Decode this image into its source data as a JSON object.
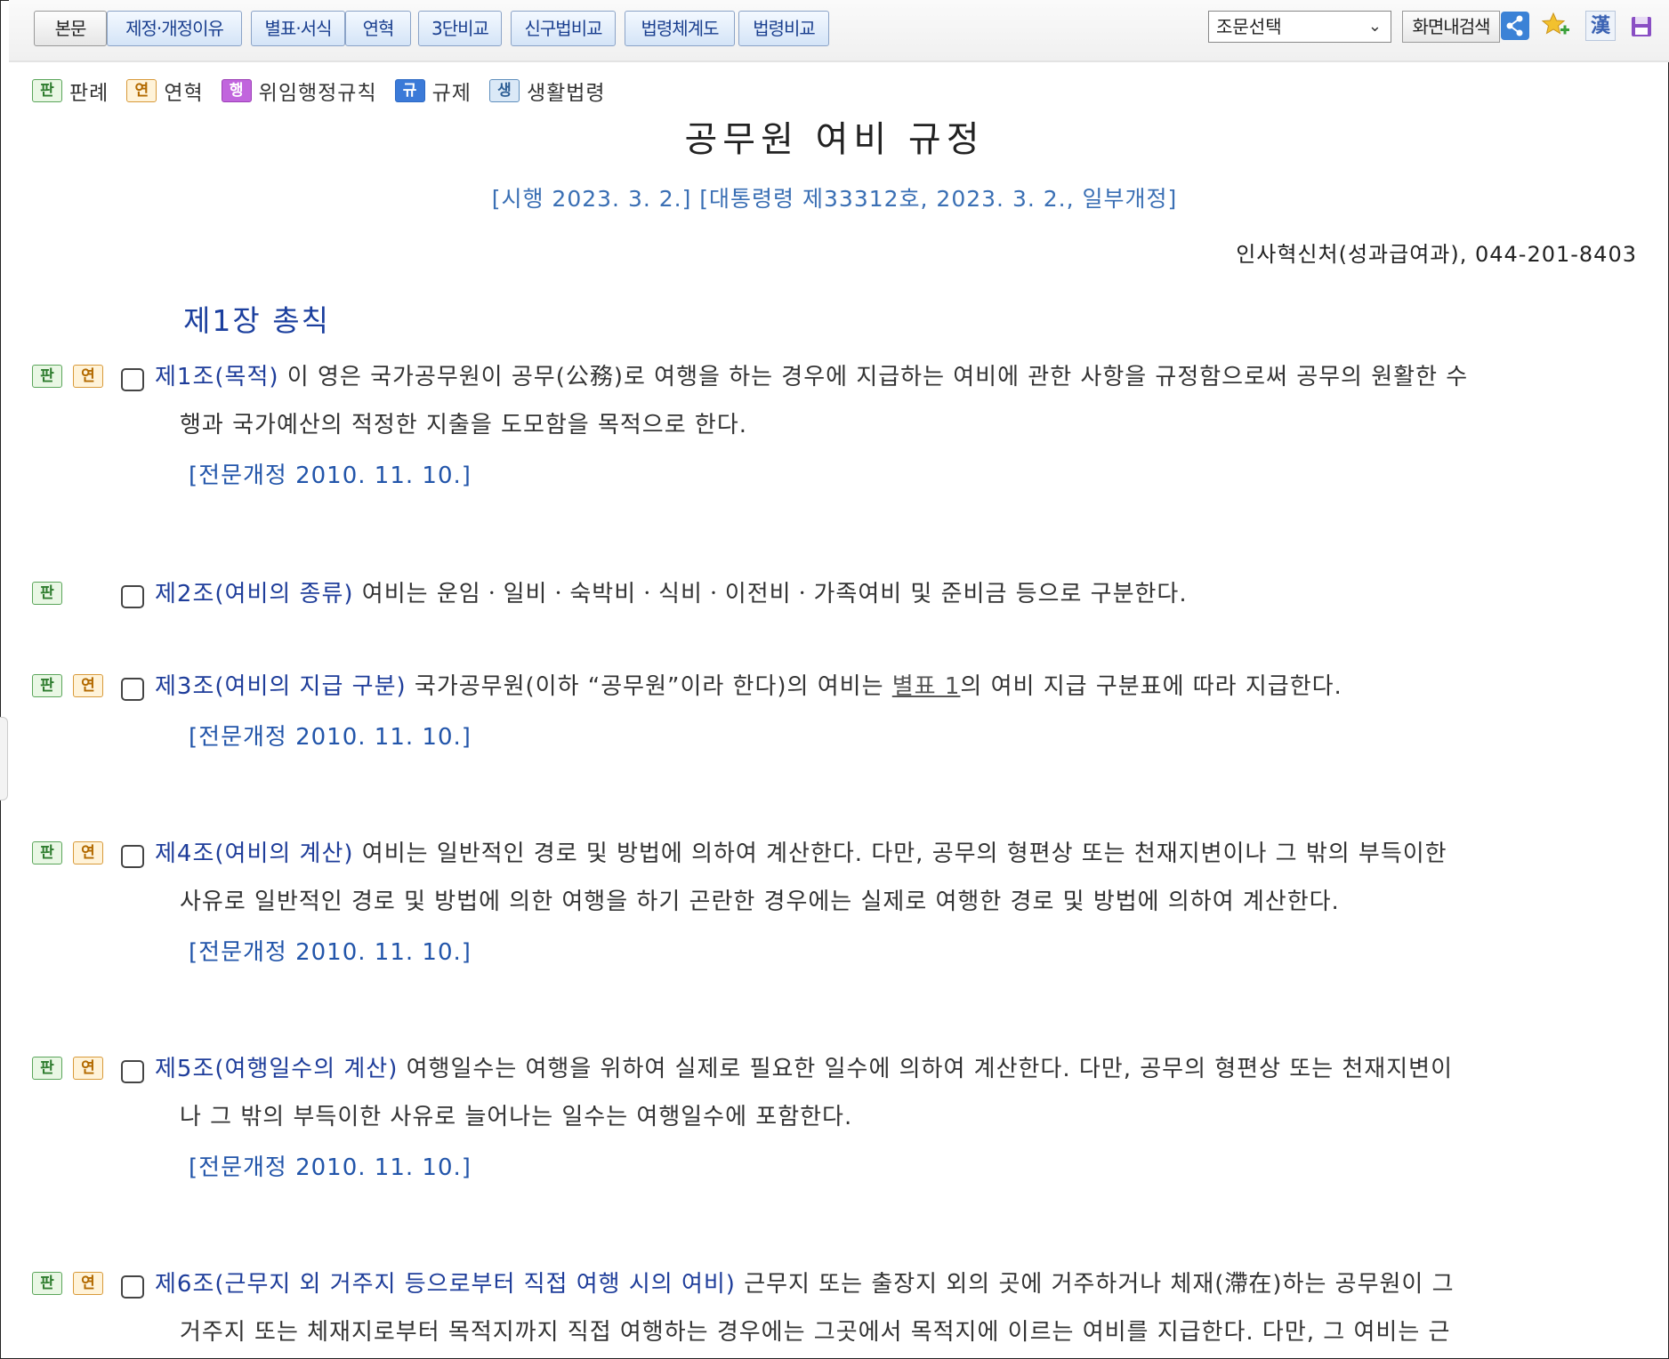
{
  "toolbar": {
    "buttons": [
      "본문",
      "제정·개정이유",
      "별표·서식",
      "연혁",
      "3단비교",
      "신구법비교",
      "법령체계도",
      "법령비교"
    ],
    "article_select": "조문선택",
    "search_button": "화면내검색",
    "icons": [
      "share-icon",
      "favorite-add-icon",
      "hanja-icon",
      "save-icon"
    ],
    "hanja_glyph": "漢"
  },
  "legend": [
    {
      "badge": "판",
      "label": "판례"
    },
    {
      "badge": "연",
      "label": "연혁"
    },
    {
      "badge": "행",
      "label": "위임행정규칙"
    },
    {
      "badge": "규",
      "label": "규제"
    },
    {
      "badge": "생",
      "label": "생활법령"
    }
  ],
  "law": {
    "title": "공무원 여비 규정",
    "enforcement": "[시행 2023. 3. 2.] [대통령령 제33312호, 2023. 3. 2., 일부개정]",
    "department": "인사혁신처(성과급여과), 044-201-8403",
    "chapter": "제1장 총칙"
  },
  "articles": [
    {
      "heading": "제1조(목적)",
      "line1": " 이 영은 국가공무원이 공무(公務)로 여행을 하는 경우에 지급하는 여비에 관한 사항을 규정함으로써 공무의 원활한 수",
      "line2": "행과 국가예산의 적정한 지출을 도모함을 목적으로 한다.",
      "revision": "[전문개정 2010. 11. 10.]",
      "badges": [
        "판",
        "연"
      ]
    },
    {
      "heading": "제2조(여비의 종류)",
      "line1": " 여비는 운임ㆍ일비ㆍ숙박비ㆍ식비ㆍ이전비ㆍ가족여비 및 준비금 등으로 구분한다.",
      "badges": [
        "판"
      ]
    },
    {
      "heading": "제3조(여비의 지급 구분)",
      "line1_pre": " 국가공무원(이하 “공무원”이라 한다)의 여비는 ",
      "line1_link": "별표 1",
      "line1_post": "의 여비 지급 구분표에 따라 지급한다.",
      "revision": "[전문개정 2010. 11. 10.]",
      "badges": [
        "판",
        "연"
      ]
    },
    {
      "heading": "제4조(여비의 계산)",
      "line1": " 여비는 일반적인 경로 및 방법에 의하여 계산한다. 다만, 공무의 형편상 또는 천재지변이나 그 밖의 부득이한",
      "line2": "사유로 일반적인 경로 및 방법에 의한 여행을 하기 곤란한 경우에는 실제로 여행한 경로 및 방법에 의하여 계산한다.",
      "revision": "[전문개정 2010. 11. 10.]",
      "badges": [
        "판",
        "연"
      ]
    },
    {
      "heading": "제5조(여행일수의 계산)",
      "line1": " 여행일수는 여행을 위하여 실제로 필요한 일수에 의하여 계산한다. 다만, 공무의 형편상 또는 천재지변이",
      "line2": "나 그 밖의 부득이한 사유로 늘어나는 일수는 여행일수에 포함한다.",
      "revision": "[전문개정 2010. 11. 10.]",
      "badges": [
        "판",
        "연"
      ]
    },
    {
      "heading": "제6조(근무지 외 거주지 등으로부터 직접 여행 시의 여비)",
      "line1": " 근무지 또는 출장지 외의 곳에 거주하거나 체재(滯在)하는 공무원이 그",
      "line2": "거주지 또는 체재지로부터 목적지까지 직접 여행하는 경우에는 그곳에서 목적지에 이르는 여비를 지급한다. 다만, 그 여비는 근",
      "badges": [
        "판",
        "연"
      ]
    }
  ]
}
